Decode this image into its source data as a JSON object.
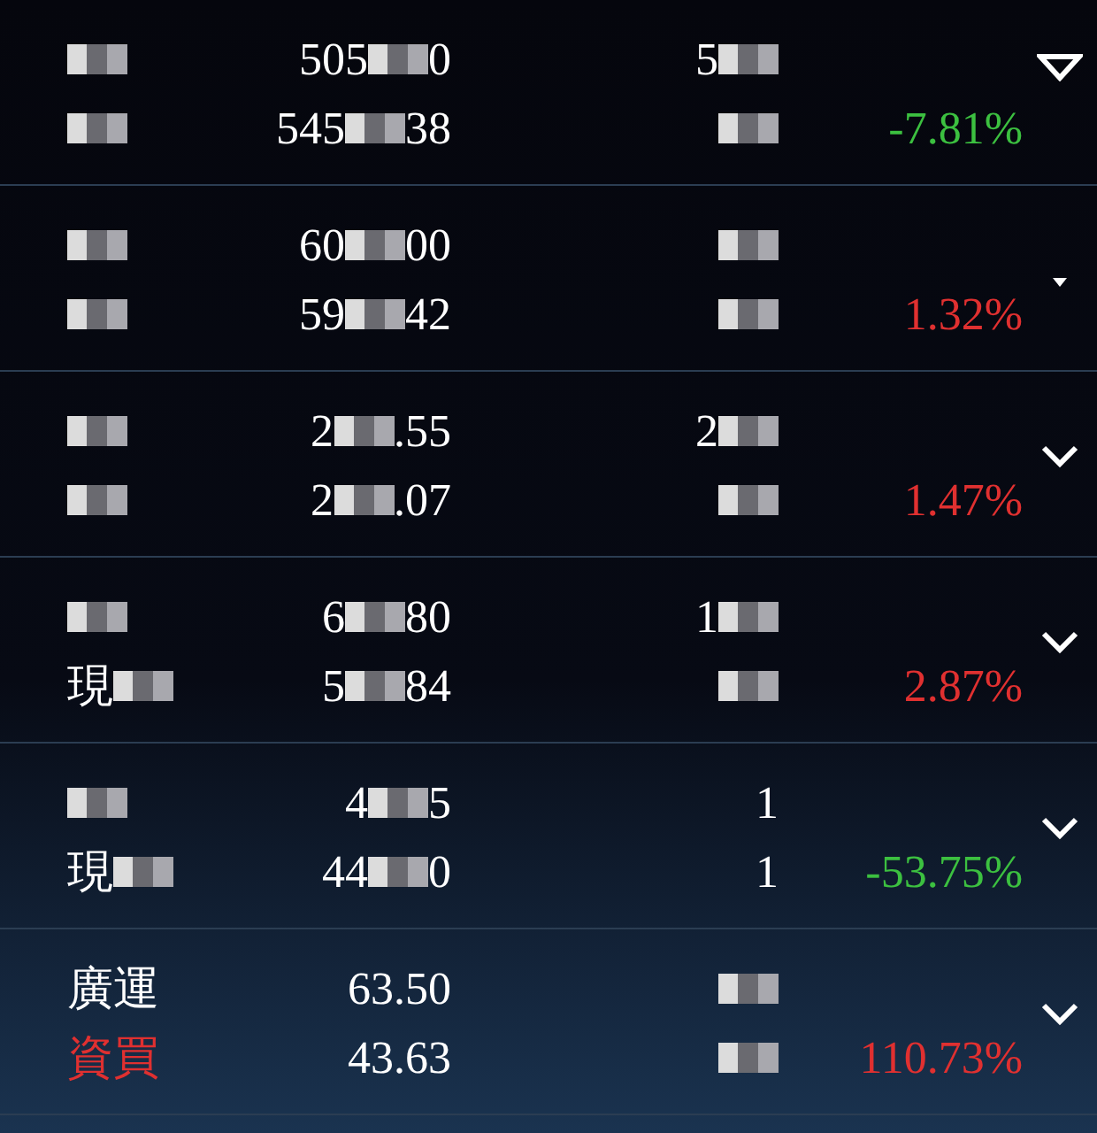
{
  "rows": [
    {
      "name": [
        {
          "parts": [
            {
              "kind": "mosaic"
            }
          ]
        },
        {
          "parts": [
            {
              "kind": "mosaic"
            }
          ]
        }
      ],
      "price": [
        {
          "parts": [
            {
              "kind": "text",
              "text": "505"
            },
            {
              "kind": "mosaic"
            },
            {
              "kind": "text",
              "text": "0"
            }
          ]
        },
        {
          "parts": [
            {
              "kind": "text",
              "text": "545"
            },
            {
              "kind": "mosaic"
            },
            {
              "kind": "text",
              "text": "38"
            }
          ]
        }
      ],
      "qty": [
        {
          "parts": [
            {
              "kind": "text",
              "text": "5"
            },
            {
              "kind": "mosaic"
            }
          ]
        },
        {
          "parts": [
            {
              "kind": "mosaic"
            }
          ]
        }
      ],
      "change": {
        "text": "-7.81%",
        "color": "#3cc040"
      },
      "toggle": {
        "kind": "triangle"
      }
    },
    {
      "name": [
        {
          "parts": [
            {
              "kind": "mosaic"
            }
          ]
        },
        {
          "parts": [
            {
              "kind": "mosaic"
            }
          ]
        }
      ],
      "price": [
        {
          "parts": [
            {
              "kind": "text",
              "text": "60"
            },
            {
              "kind": "mosaic"
            },
            {
              "kind": "text",
              "text": "00"
            }
          ]
        },
        {
          "parts": [
            {
              "kind": "text",
              "text": "59"
            },
            {
              "kind": "mosaic"
            },
            {
              "kind": "text",
              "text": "42"
            }
          ]
        }
      ],
      "qty": [
        {
          "parts": [
            {
              "kind": "mosaic"
            }
          ]
        },
        {
          "parts": [
            {
              "kind": "mosaic"
            }
          ]
        }
      ],
      "change": {
        "text": "1.32%",
        "color": "#e03030"
      },
      "toggle": {
        "kind": "caret"
      }
    },
    {
      "name": [
        {
          "parts": [
            {
              "kind": "mosaic"
            }
          ]
        },
        {
          "parts": [
            {
              "kind": "mosaic"
            }
          ]
        }
      ],
      "price": [
        {
          "parts": [
            {
              "kind": "text",
              "text": "2"
            },
            {
              "kind": "mosaic"
            },
            {
              "kind": "text",
              "text": ".55"
            }
          ]
        },
        {
          "parts": [
            {
              "kind": "text",
              "text": "2"
            },
            {
              "kind": "mosaic"
            },
            {
              "kind": "text",
              "text": ".07"
            }
          ]
        }
      ],
      "qty": [
        {
          "parts": [
            {
              "kind": "text",
              "text": "2"
            },
            {
              "kind": "mosaic"
            }
          ]
        },
        {
          "parts": [
            {
              "kind": "mosaic"
            }
          ]
        }
      ],
      "change": {
        "text": "1.47%",
        "color": "#e03030"
      },
      "toggle": {
        "kind": "chevron"
      }
    },
    {
      "name": [
        {
          "parts": [
            {
              "kind": "mosaic"
            }
          ]
        },
        {
          "parts": [
            {
              "kind": "text",
              "text": "現",
              "color": "#ffffff"
            },
            {
              "kind": "mosaic"
            }
          ]
        }
      ],
      "price": [
        {
          "parts": [
            {
              "kind": "text",
              "text": "6"
            },
            {
              "kind": "mosaic"
            },
            {
              "kind": "text",
              "text": "80"
            }
          ]
        },
        {
          "parts": [
            {
              "kind": "text",
              "text": "5"
            },
            {
              "kind": "mosaic"
            },
            {
              "kind": "text",
              "text": "84"
            }
          ]
        }
      ],
      "qty": [
        {
          "parts": [
            {
              "kind": "text",
              "text": "1"
            },
            {
              "kind": "mosaic"
            }
          ]
        },
        {
          "parts": [
            {
              "kind": "mosaic"
            }
          ]
        }
      ],
      "change": {
        "text": "2.87%",
        "color": "#e03030"
      },
      "toggle": {
        "kind": "chevron"
      }
    },
    {
      "name": [
        {
          "parts": [
            {
              "kind": "mosaic"
            }
          ]
        },
        {
          "parts": [
            {
              "kind": "text",
              "text": "現",
              "color": "#ffffff"
            },
            {
              "kind": "mosaic"
            }
          ]
        }
      ],
      "price": [
        {
          "parts": [
            {
              "kind": "text",
              "text": "4"
            },
            {
              "kind": "mosaic"
            },
            {
              "kind": "text",
              "text": "5"
            }
          ]
        },
        {
          "parts": [
            {
              "kind": "text",
              "text": "44"
            },
            {
              "kind": "mosaic"
            },
            {
              "kind": "text",
              "text": "0"
            }
          ]
        }
      ],
      "qty": [
        {
          "parts": [
            {
              "kind": "text",
              "text": "1"
            }
          ]
        },
        {
          "parts": [
            {
              "kind": "text",
              "text": "1"
            }
          ]
        }
      ],
      "change": {
        "text": "-53.75%",
        "color": "#3cc040"
      },
      "toggle": {
        "kind": "chevron"
      }
    },
    {
      "name": [
        {
          "parts": [
            {
              "kind": "text",
              "text": "廣運",
              "color": "#ffffff"
            }
          ]
        },
        {
          "parts": [
            {
              "kind": "text",
              "text": "資買",
              "color": "#e03030"
            }
          ]
        }
      ],
      "price": [
        {
          "parts": [
            {
              "kind": "text",
              "text": "63.50"
            }
          ]
        },
        {
          "parts": [
            {
              "kind": "text",
              "text": "43.63"
            }
          ]
        }
      ],
      "qty": [
        {
          "parts": [
            {
              "kind": "mosaic"
            }
          ]
        },
        {
          "parts": [
            {
              "kind": "mosaic"
            }
          ]
        }
      ],
      "change": {
        "text": "110.73%",
        "color": "#e03030"
      },
      "toggle": {
        "kind": "chevron"
      }
    }
  ]
}
